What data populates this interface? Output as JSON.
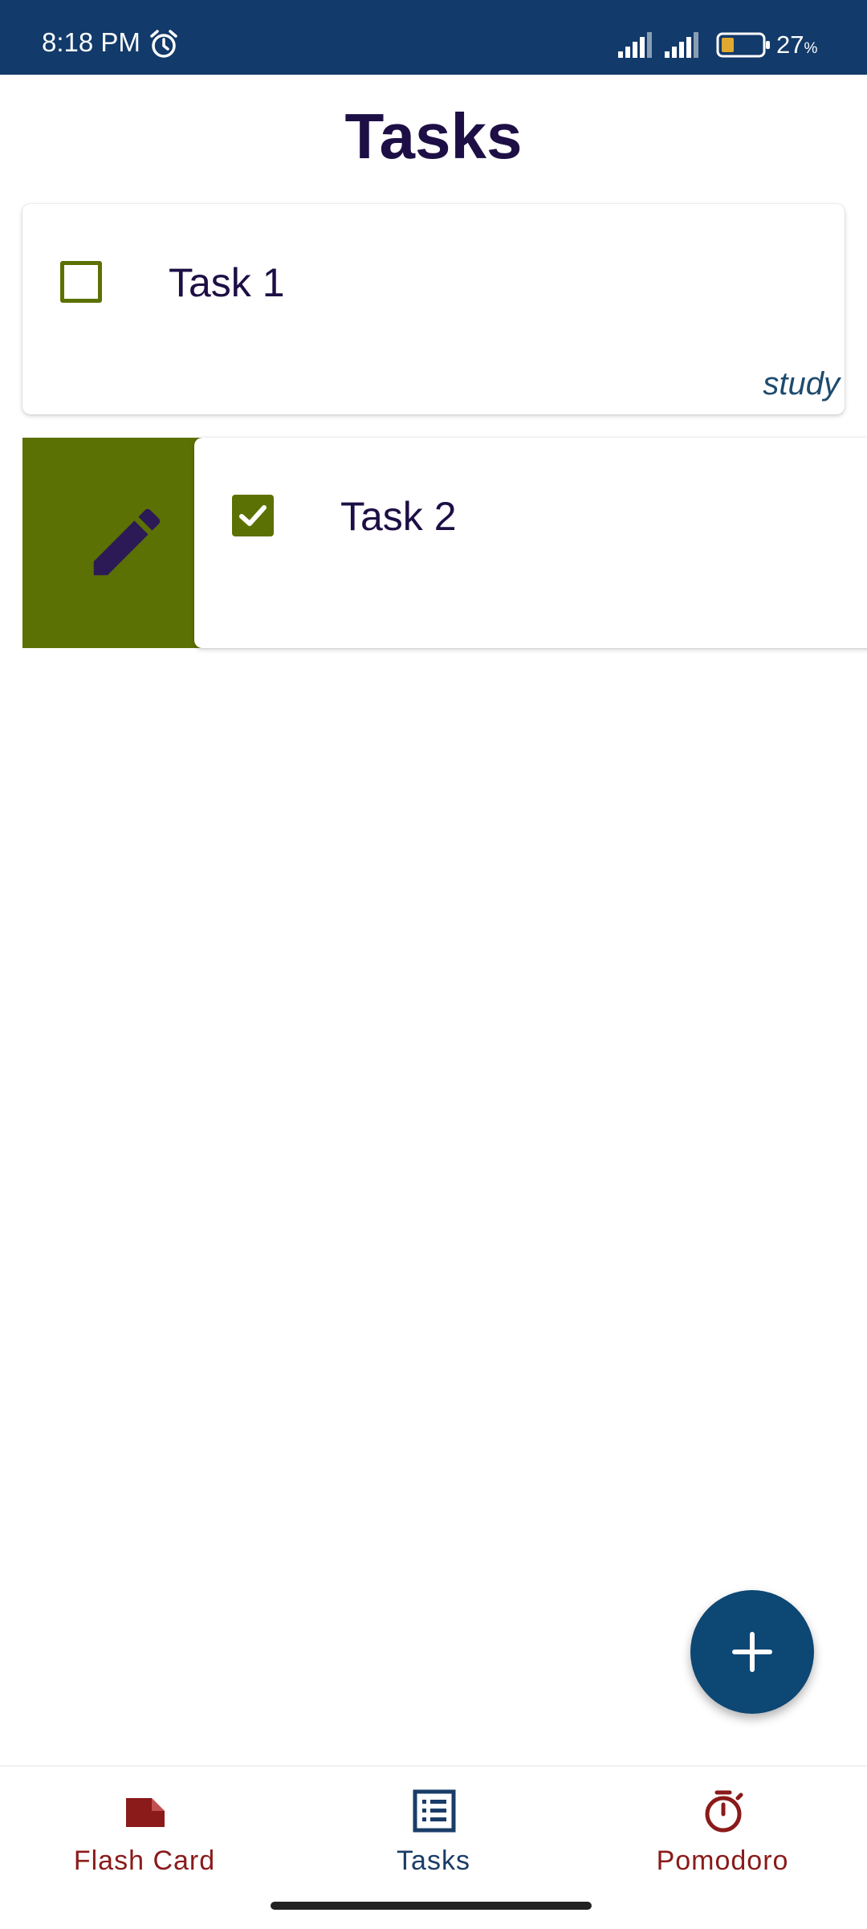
{
  "status_bar": {
    "time": "8:18 PM",
    "battery_percent": "27",
    "battery_unit": "%",
    "icons": [
      "alarm-icon",
      "signal-icon",
      "signal-icon",
      "battery-icon"
    ]
  },
  "page": {
    "title": "Tasks"
  },
  "tasks": [
    {
      "title": "Task 1",
      "category": "study",
      "checked": false
    },
    {
      "title": "Task 2",
      "category": "",
      "checked": true
    }
  ],
  "swipe_action": {
    "icon": "edit-icon",
    "color": "#5c7103"
  },
  "fab": {
    "icon": "plus-icon",
    "color": "#0d4774"
  },
  "bottom_nav": {
    "items": [
      {
        "label": "Flash Card",
        "icon": "flash-card-icon",
        "color": "#8b1a1a",
        "selected": false
      },
      {
        "label": "Tasks",
        "icon": "tasks-list-icon",
        "color": "#1a3d68",
        "selected": true
      },
      {
        "label": "Pomodoro",
        "icon": "timer-icon",
        "color": "#8b1a1a",
        "selected": false
      }
    ]
  },
  "colors": {
    "status_bar": "#123a6a",
    "title": "#1d0f45",
    "accent_green": "#5c7103",
    "edit_icon": "#2b1a55"
  }
}
